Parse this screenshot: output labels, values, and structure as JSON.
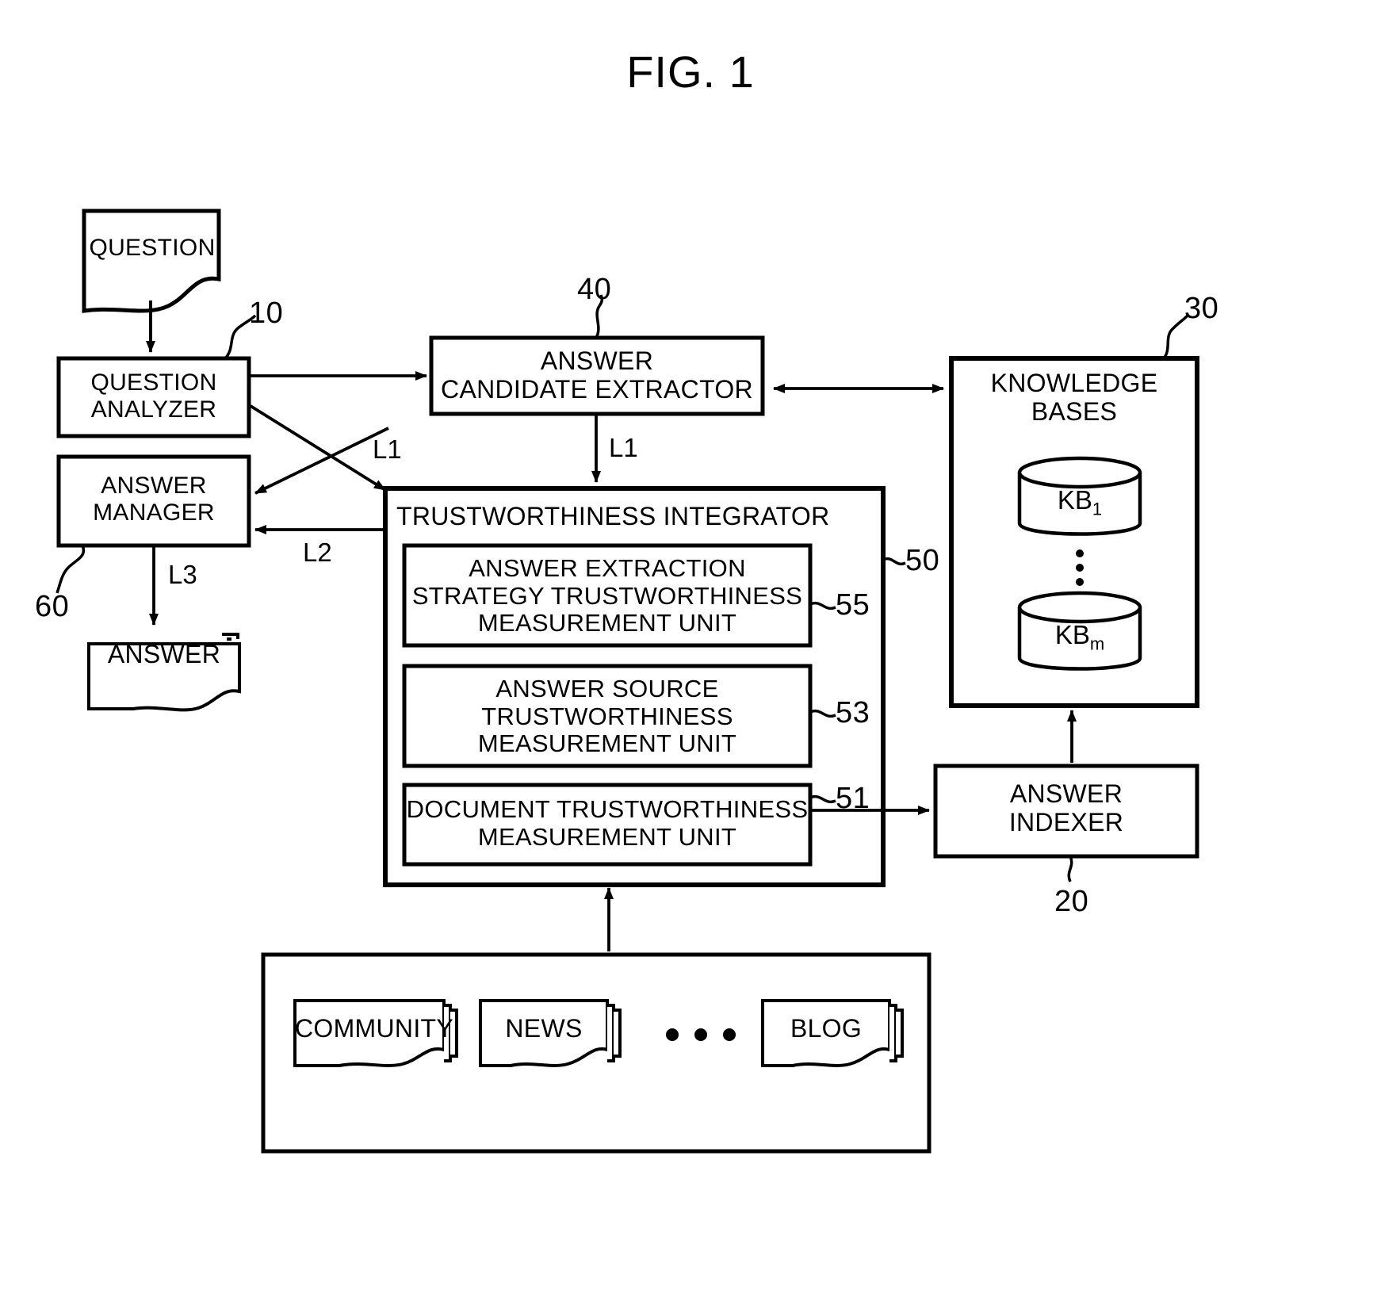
{
  "figure": {
    "title": "FIG. 1",
    "type": "block-diagram"
  },
  "nodes": {
    "question_doc": {
      "label": "QUESTION",
      "shape": "document"
    },
    "question_analyzer": {
      "label": "QUESTION\nANALYZER",
      "ref": "10",
      "shape": "rect"
    },
    "answer_manager": {
      "label": "ANSWER\nMANAGER",
      "ref": "60",
      "shape": "rect"
    },
    "answer_doc": {
      "label": "ANSWER",
      "shape": "document-stack"
    },
    "answer_candidate_extractor": {
      "label": "ANSWER\nCANDIDATE EXTRACTOR",
      "ref": "40",
      "shape": "rect"
    },
    "trustworthiness_integrator": {
      "label": "TRUSTWORTHINESS INTEGRATOR",
      "ref": "50",
      "shape": "rect"
    },
    "unit_55": {
      "label": "ANSWER EXTRACTION\nSTRATEGY TRUSTWORTHINESS\nMEASUREMENT UNIT",
      "ref": "55",
      "shape": "rect"
    },
    "unit_53": {
      "label": "ANSWER SOURCE\nTRUSTWORTHINESS\nMEASUREMENT UNIT",
      "ref": "53",
      "shape": "rect"
    },
    "unit_51": {
      "label": "DOCUMENT TRUSTWORTHINESS\nMEASUREMENT UNIT",
      "ref": "51",
      "shape": "rect"
    },
    "knowledge_bases": {
      "label": "KNOWLEDGE\nBASES",
      "ref": "30",
      "shape": "rect"
    },
    "kb_first": {
      "label": "KB",
      "subscript": "1",
      "shape": "cylinder"
    },
    "kb_last": {
      "label": "KB",
      "subscript": "m",
      "shape": "cylinder"
    },
    "kb_ellipsis": {
      "label": "⋮"
    },
    "answer_indexer": {
      "label": "ANSWER\nINDEXER",
      "ref": "20",
      "shape": "rect"
    },
    "document_sources": {
      "shape": "rect"
    },
    "source_community": {
      "label": "COMMUNITY",
      "shape": "document-stack"
    },
    "source_news": {
      "label": "NEWS",
      "shape": "document-stack"
    },
    "source_ellipsis": {
      "label": "• • •"
    },
    "source_blog": {
      "label": "BLOG",
      "shape": "document-stack"
    }
  },
  "edge_labels": {
    "l1_analyzer_to_integrator": "L1",
    "l1_extractor_to_integrator": "L1",
    "l2_integrator_to_manager": "L2",
    "l3_manager_to_answer": "L3"
  },
  "ref_numbers": {
    "question_analyzer": "10",
    "answer_indexer": "20",
    "knowledge_bases": "30",
    "answer_candidate_extractor": "40",
    "trustworthiness_integrator": "50",
    "unit_document": "51",
    "unit_answer_source": "53",
    "unit_answer_extraction_strategy": "55",
    "answer_manager": "60"
  },
  "colors": {
    "stroke": "#000000",
    "background": "#ffffff"
  }
}
